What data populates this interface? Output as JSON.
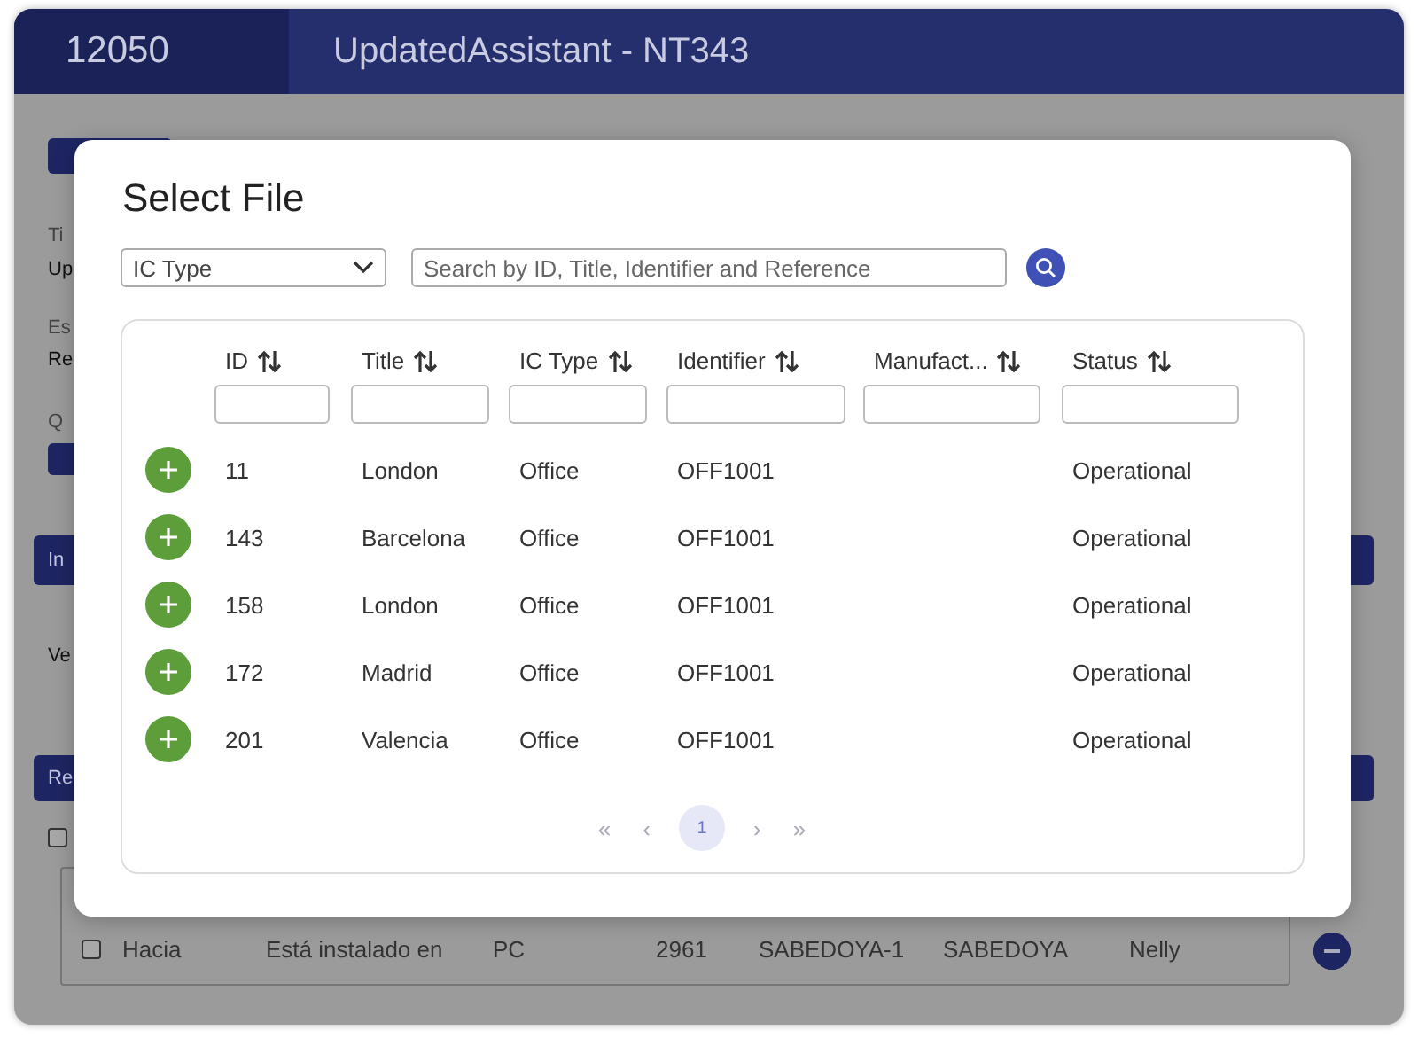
{
  "background": {
    "id": "12050",
    "title": "UpdatedAssistant - NT343",
    "fields": [
      {
        "label": "Ti",
        "value": "Up"
      },
      {
        "label": "Es",
        "value": "Re"
      }
    ],
    "q_label": "Q",
    "info_button": "In",
    "info_text": "Ve",
    "relations_button": "Re",
    "select_all": {
      "checked": false
    },
    "relations_rows": [
      {
        "checked": false,
        "cells": [
          "Hacia",
          "Está instalado en",
          "PC",
          "2961",
          "SABEDOYA-1",
          "SABEDOYA",
          "Nelly"
        ]
      }
    ]
  },
  "dialog": {
    "title": "Select File",
    "type_filter": {
      "value": "IC Type"
    },
    "search": {
      "placeholder": "Search by ID, Title, Identifier and Reference"
    },
    "columns": [
      "ID",
      "Title",
      "IC Type",
      "Identifier",
      "Manufact...",
      "Status"
    ],
    "rows": [
      {
        "id": "11",
        "title": "London",
        "ic_type": "Office",
        "identifier": "OFF1001",
        "status": "Operational"
      },
      {
        "id": "143",
        "title": "Barcelona",
        "ic_type": "Office",
        "identifier": "OFF1001",
        "status": "Operational"
      },
      {
        "id": "158",
        "title": "London",
        "ic_type": "Office",
        "identifier": "OFF1001",
        "status": "Operational"
      },
      {
        "id": "172",
        "title": "Madrid",
        "ic_type": "Office",
        "identifier": "OFF1001",
        "status": "Operational"
      },
      {
        "id": "201",
        "title": "Valencia",
        "ic_type": "Office",
        "identifier": "OFF1001",
        "status": "Operational"
      }
    ],
    "pagination": {
      "first": "«",
      "prev": "‹",
      "next": "›",
      "last": "»",
      "pages": [
        {
          "label": "1",
          "selected": true
        }
      ]
    }
  }
}
